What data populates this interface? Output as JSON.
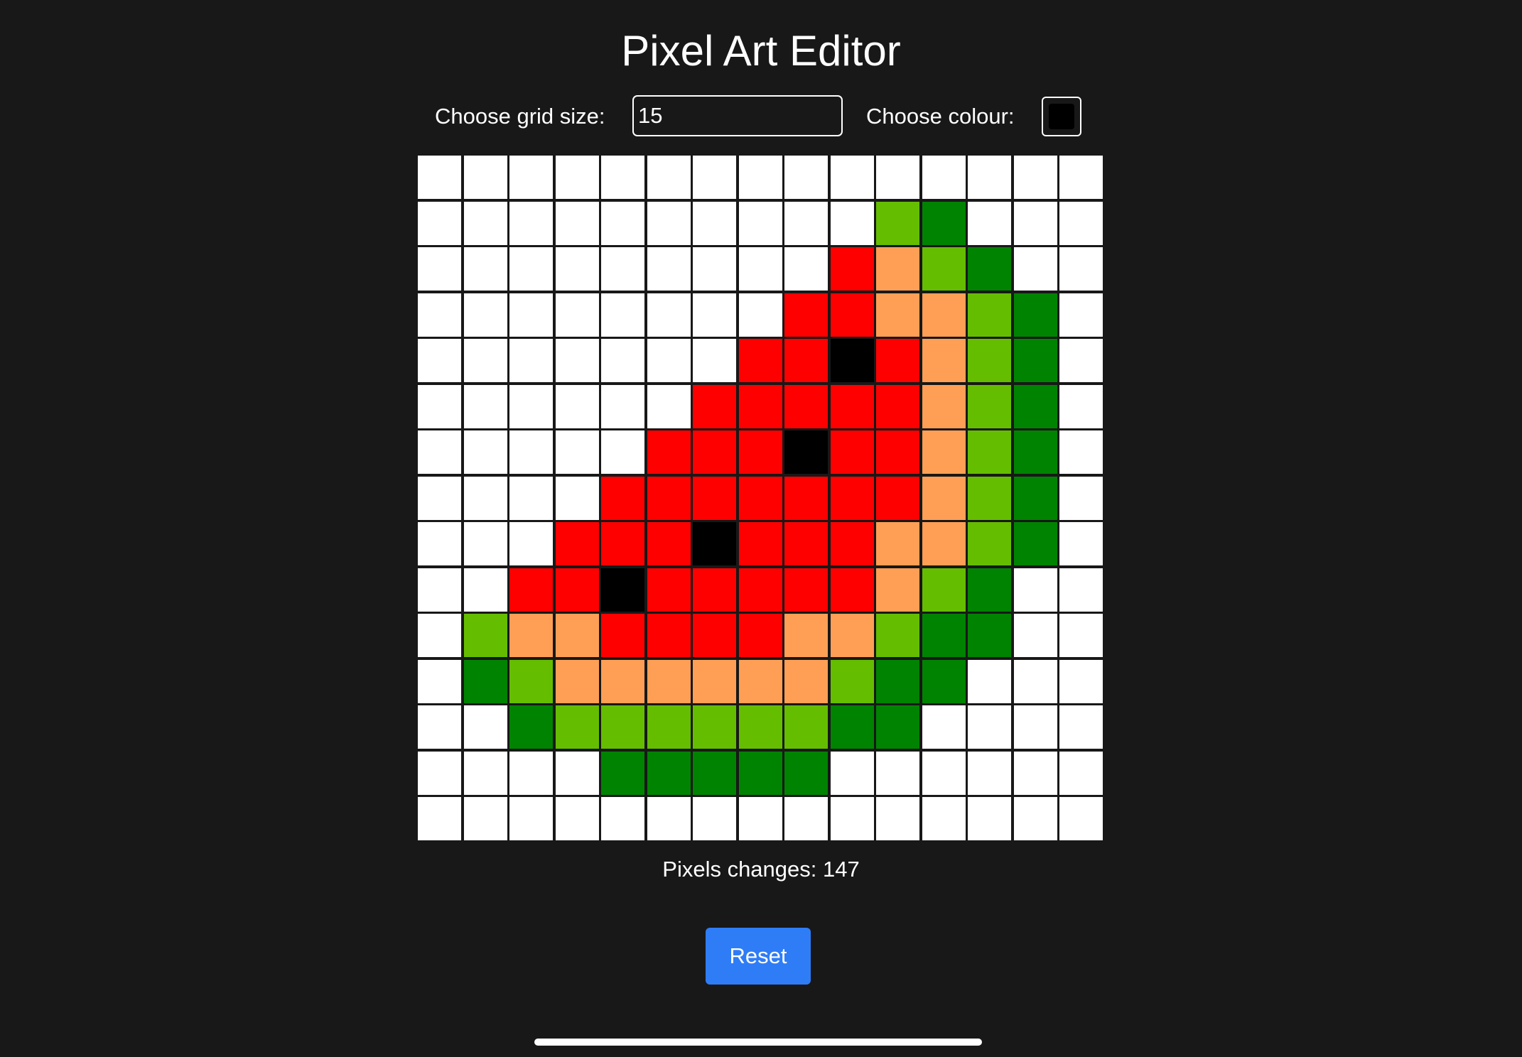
{
  "header": {
    "title": "Pixel Art Editor"
  },
  "controls": {
    "grid_size_label": "Choose grid size:",
    "grid_size_value": "15",
    "colour_label": "Choose colour:",
    "colour_value": "#000000"
  },
  "palette": {
    "W": "#ffffff",
    "R": "#ff0000",
    "O": "#ff9f55",
    "L": "#65bd00",
    "G": "#008300",
    "K": "#000000"
  },
  "grid": {
    "size": 15,
    "rows": [
      "WWWWWWWWWWWWWWW",
      "WWWWWWWWWWLGWWW",
      "WWWWWWWWWROLGWW",
      "WWWWWWWWRROOLGW",
      "WWWWWWWRRKROLGW",
      "WWWWWWRRRRROLGW",
      "WWWWWRRRKRROLGW",
      "WWWWRRRRRRROLGW",
      "WWWRRRKRRROOLGW",
      "WWRRKRRRRROLGWW",
      "WLOORRRROOLGGWW",
      "WGLOOOOOOLGGWWW",
      "WWGLLLLLLGGWWWW",
      "WWWWGGGGGWWWWWW",
      "WWWWWWWWWWWWWWW"
    ]
  },
  "status": {
    "counter_text": "Pixels changes: 147"
  },
  "actions": {
    "reset_label": "Reset"
  }
}
